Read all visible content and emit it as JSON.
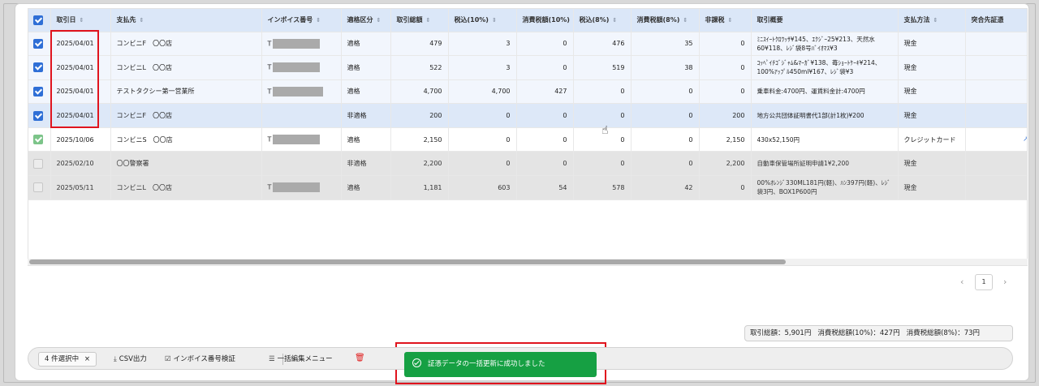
{
  "table": {
    "headers": [
      {
        "label": "取引日",
        "sort": "⇕"
      },
      {
        "label": "支払先",
        "sort": "⇕"
      },
      {
        "label": "インボイス番号",
        "sort": "⇕"
      },
      {
        "label": "適格区分",
        "sort": "⇕"
      },
      {
        "label": "取引総額",
        "sort": "⇕"
      },
      {
        "label": "税込(10%)",
        "sort": "⇕"
      },
      {
        "label": "消費税額(10%)",
        "sort": "⇕"
      },
      {
        "label": "税込(8%)",
        "sort": "⇕"
      },
      {
        "label": "消費税額(8%)",
        "sort": "⇕"
      },
      {
        "label": "非課税",
        "sort": "⇕"
      },
      {
        "label": "取引概要",
        "sort": ""
      },
      {
        "label": "支払方法",
        "sort": "⇕"
      },
      {
        "label": "突合先証憑",
        "sort": ""
      }
    ],
    "rows": [
      {
        "date": "2025/04/01",
        "payee": "コンビニF　〇〇店",
        "invoice_prefix": "T",
        "qualified": "適格",
        "total": "479",
        "tax_incl_10": "3",
        "tax_10": "0",
        "tax_incl_8": "476",
        "tax_8": "35",
        "non_taxable": "0",
        "summary": "ﾐﾆｽｲｰﾄｸﾛﾜｯｻ¥145、ｴｸｼﾞｰ25¥213、天然水60¥118、ﾚｼﾞ袋8号ﾊﾞｲｵﾏｽ¥3",
        "payment": "現金"
      },
      {
        "date": "2025/04/01",
        "payee": "コンビニL　〇〇店",
        "invoice_prefix": "T",
        "qualified": "適格",
        "total": "522",
        "tax_incl_10": "3",
        "tax_10": "0",
        "tax_incl_8": "519",
        "tax_8": "38",
        "non_taxable": "0",
        "summary": "ｺｯﾍﾟｲﾁｺﾞｼﾞｬﾑ&ﾏｰｶﾞ¥138、苺ｼｮｰﾄｹｰｷ¥214、100%ｱｯﾌﾟﾙ450ml¥167、ﾚｼﾞ袋¥3",
        "payment": "現金"
      },
      {
        "date": "2025/04/01",
        "payee": "テストタクシー第一営業所",
        "invoice_prefix": "T",
        "qualified": "適格",
        "total": "4,700",
        "tax_incl_10": "4,700",
        "tax_10": "427",
        "tax_incl_8": "0",
        "tax_8": "0",
        "non_taxable": "0",
        "summary": "乗車料金:4700円、運賃料金計:4700円",
        "payment": "現金"
      },
      {
        "date": "2025/04/01",
        "payee": "コンビニF　〇〇店",
        "invoice_prefix": "",
        "qualified": "非適格",
        "total": "200",
        "tax_incl_10": "0",
        "tax_10": "0",
        "tax_incl_8": "0",
        "tax_8": "0",
        "non_taxable": "200",
        "summary": "地方公共団体証明書代1部(計1枚)¥200",
        "payment": "現金"
      },
      {
        "date": "2025/10/06",
        "payee": "コンビニS　〇〇店",
        "invoice_prefix": "T",
        "qualified": "適格",
        "total": "2,150",
        "tax_incl_10": "0",
        "tax_10": "0",
        "tax_incl_8": "0",
        "tax_8": "0",
        "non_taxable": "2,150",
        "summary": "430x52,150円",
        "payment": "クレジットカード"
      },
      {
        "date": "2025/02/10",
        "payee": "〇〇警察署",
        "invoice_prefix": "",
        "qualified": "非適格",
        "total": "2,200",
        "tax_incl_10": "0",
        "tax_10": "0",
        "tax_incl_8": "0",
        "tax_8": "0",
        "non_taxable": "2,200",
        "summary": "自動車保管場所証明申請1¥2,200",
        "payment": "現金"
      },
      {
        "date": "2025/05/11",
        "payee": "コンビニL　〇〇店",
        "invoice_prefix": "T",
        "qualified": "適格",
        "total": "1,181",
        "tax_incl_10": "603",
        "tax_10": "54",
        "tax_incl_8": "578",
        "tax_8": "42",
        "non_taxable": "0",
        "summary": "00%ｵﾚﾝｼﾞ330ML181円(軽)、ﾊﾝ397円(軽)、ﾚｼﾞ袋3円、BOX1P600円",
        "payment": "現金"
      }
    ]
  },
  "pagination": {
    "current": "1",
    "prev": "‹",
    "next": "›"
  },
  "totals": {
    "total": "取引総額：5,901円",
    "tax10": "消費税総額(10%)：427円",
    "tax8": "消費税総額(8%)：73円"
  },
  "action_bar": {
    "selected": "4 件選択中",
    "clear": "×",
    "csv": "CSV出力",
    "invoice_check": "インボイス番号検証",
    "bulk_menu": "一括編集メニュー"
  },
  "toast": {
    "message": "証憑データの一括更新に成功しました"
  },
  "colors": {
    "accent": "#2f6fd6",
    "success": "#16a043",
    "highlight": "#e0141e"
  }
}
